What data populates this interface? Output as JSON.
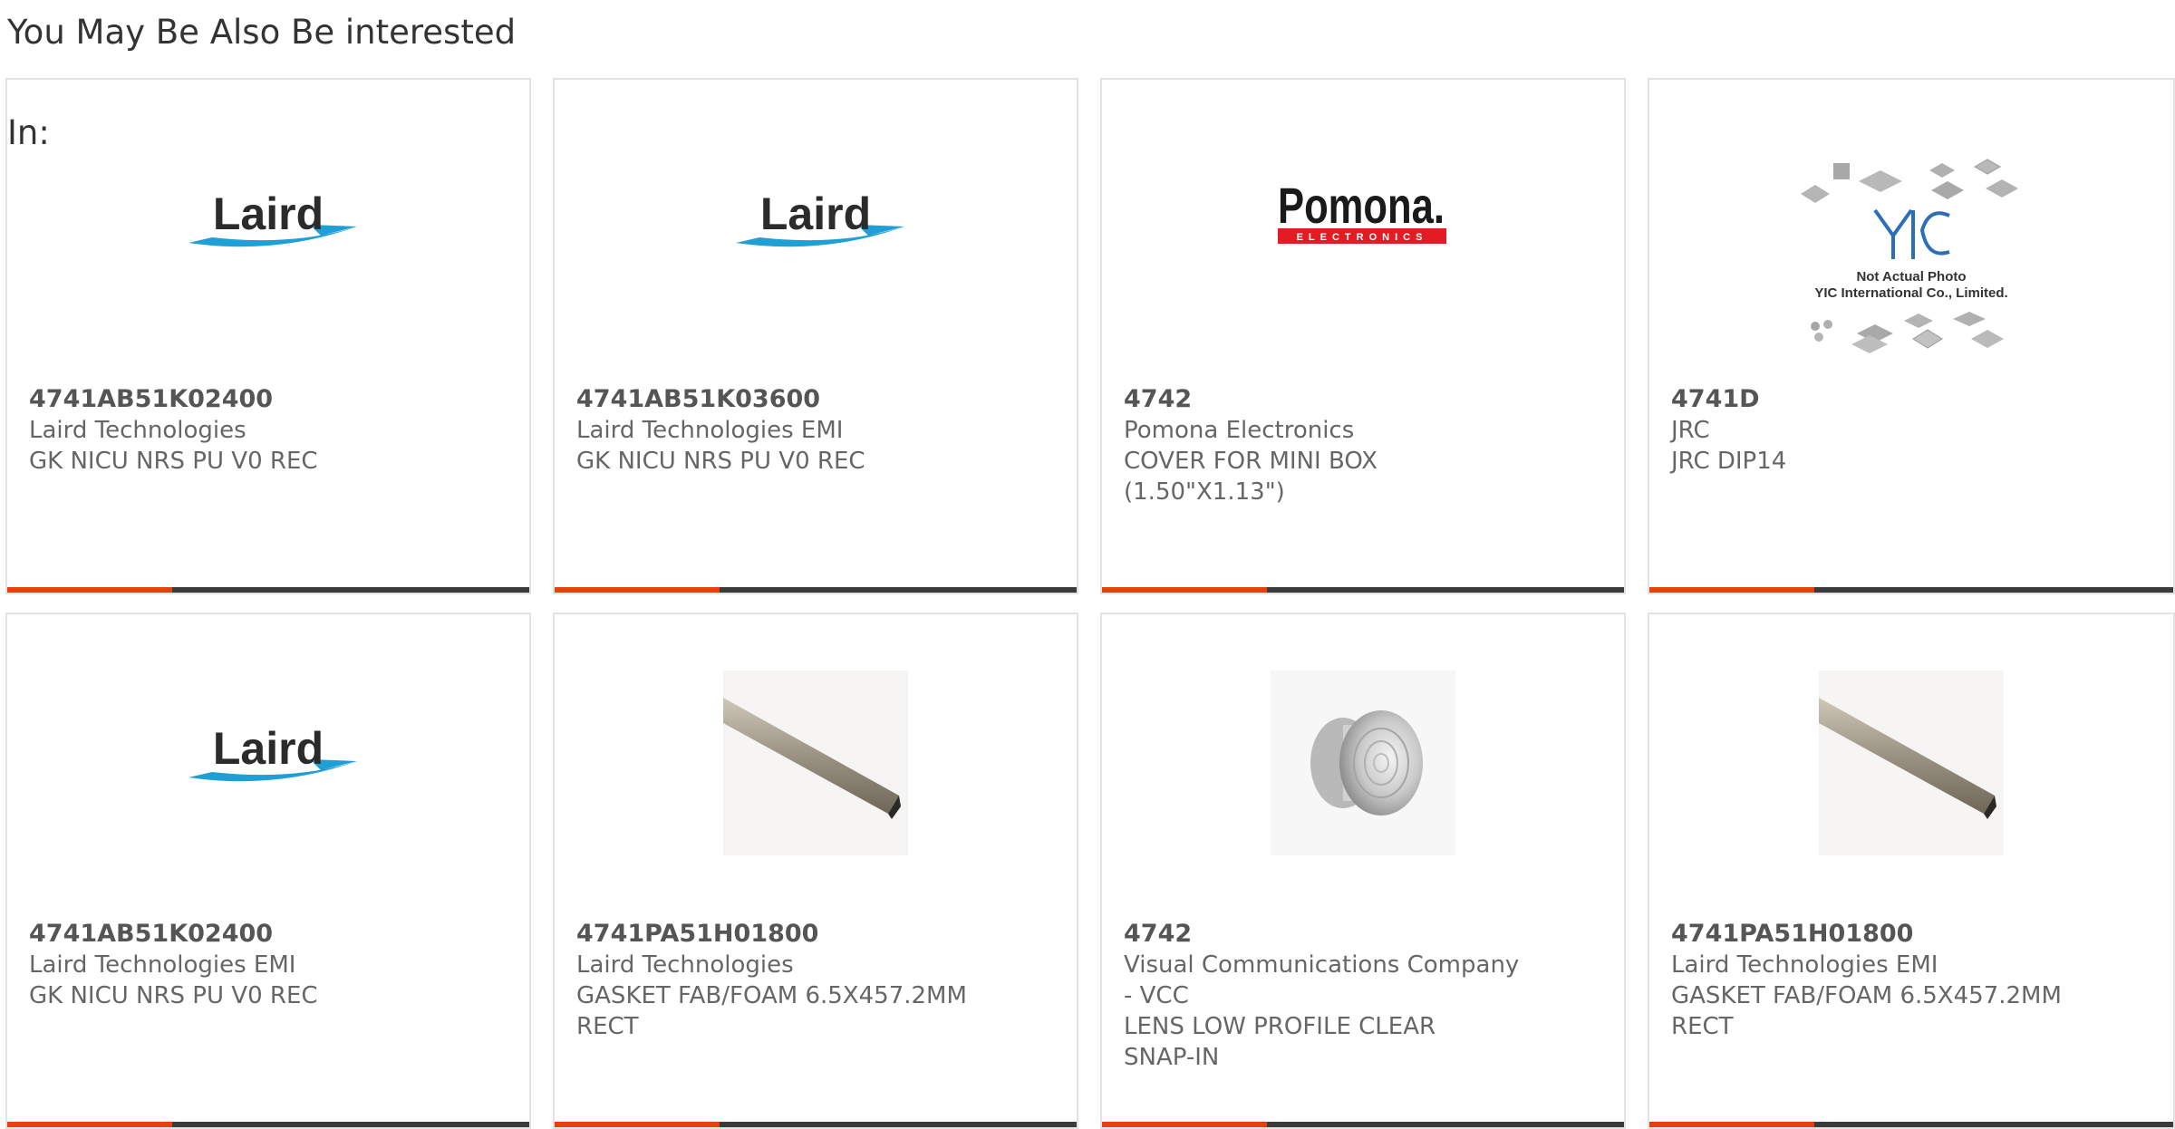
{
  "section": {
    "heading_line1": "You May Be Also Be interested",
    "heading_line2": "In:"
  },
  "products": [
    {
      "part_number": "4741AB51K02400",
      "manufacturer": "Laird Technologies",
      "description_lines": [
        "GK NICU NRS PU V0 REC"
      ],
      "image": "laird-logo",
      "logo_text": "Laird"
    },
    {
      "part_number": "4741AB51K03600",
      "manufacturer": "Laird Technologies EMI",
      "description_lines": [
        "GK NICU NRS PU V0 REC"
      ],
      "image": "laird-logo",
      "logo_text": "Laird"
    },
    {
      "part_number": "4742",
      "manufacturer": "Pomona Electronics",
      "description_lines": [
        "COVER FOR MINI BOX",
        "(1.50\"X1.13\")"
      ],
      "image": "pomona-logo",
      "logo_text": "Pomona.",
      "logo_subtext": "ELECTRONICS"
    },
    {
      "part_number": "4741D",
      "manufacturer": "JRC",
      "description_lines": [
        "JRC DIP14"
      ],
      "image": "yic-placeholder",
      "placeholder_line1": "Not Actual Photo",
      "placeholder_line2": "YIC International Co., Limited."
    },
    {
      "part_number": "4741AB51K02400",
      "manufacturer": "Laird Technologies EMI",
      "description_lines": [
        "GK NICU NRS PU V0 REC"
      ],
      "image": "laird-logo",
      "logo_text": "Laird"
    },
    {
      "part_number": "4741PA51H01800",
      "manufacturer": "Laird Technologies",
      "description_lines": [
        "GASKET FAB/FOAM 6.5X457.2MM",
        "RECT"
      ],
      "image": "gasket-rod-photo"
    },
    {
      "part_number": "4742",
      "manufacturer_lines": [
        "Visual Communications Company",
        "- VCC"
      ],
      "description_lines": [
        "LENS LOW PROFILE CLEAR",
        "SNAP-IN"
      ],
      "image": "lens-photo"
    },
    {
      "part_number": "4741PA51H01800",
      "manufacturer": "Laird Technologies EMI",
      "description_lines": [
        "GASKET FAB/FOAM 6.5X457.2MM",
        "RECT"
      ],
      "image": "gasket-rod-photo"
    }
  ],
  "colors": {
    "accent_bar": "#e8400c",
    "dark_bar": "#3b3b3b",
    "laird_blue": "#1e9fd6",
    "pomona_red": "#e31b23"
  }
}
